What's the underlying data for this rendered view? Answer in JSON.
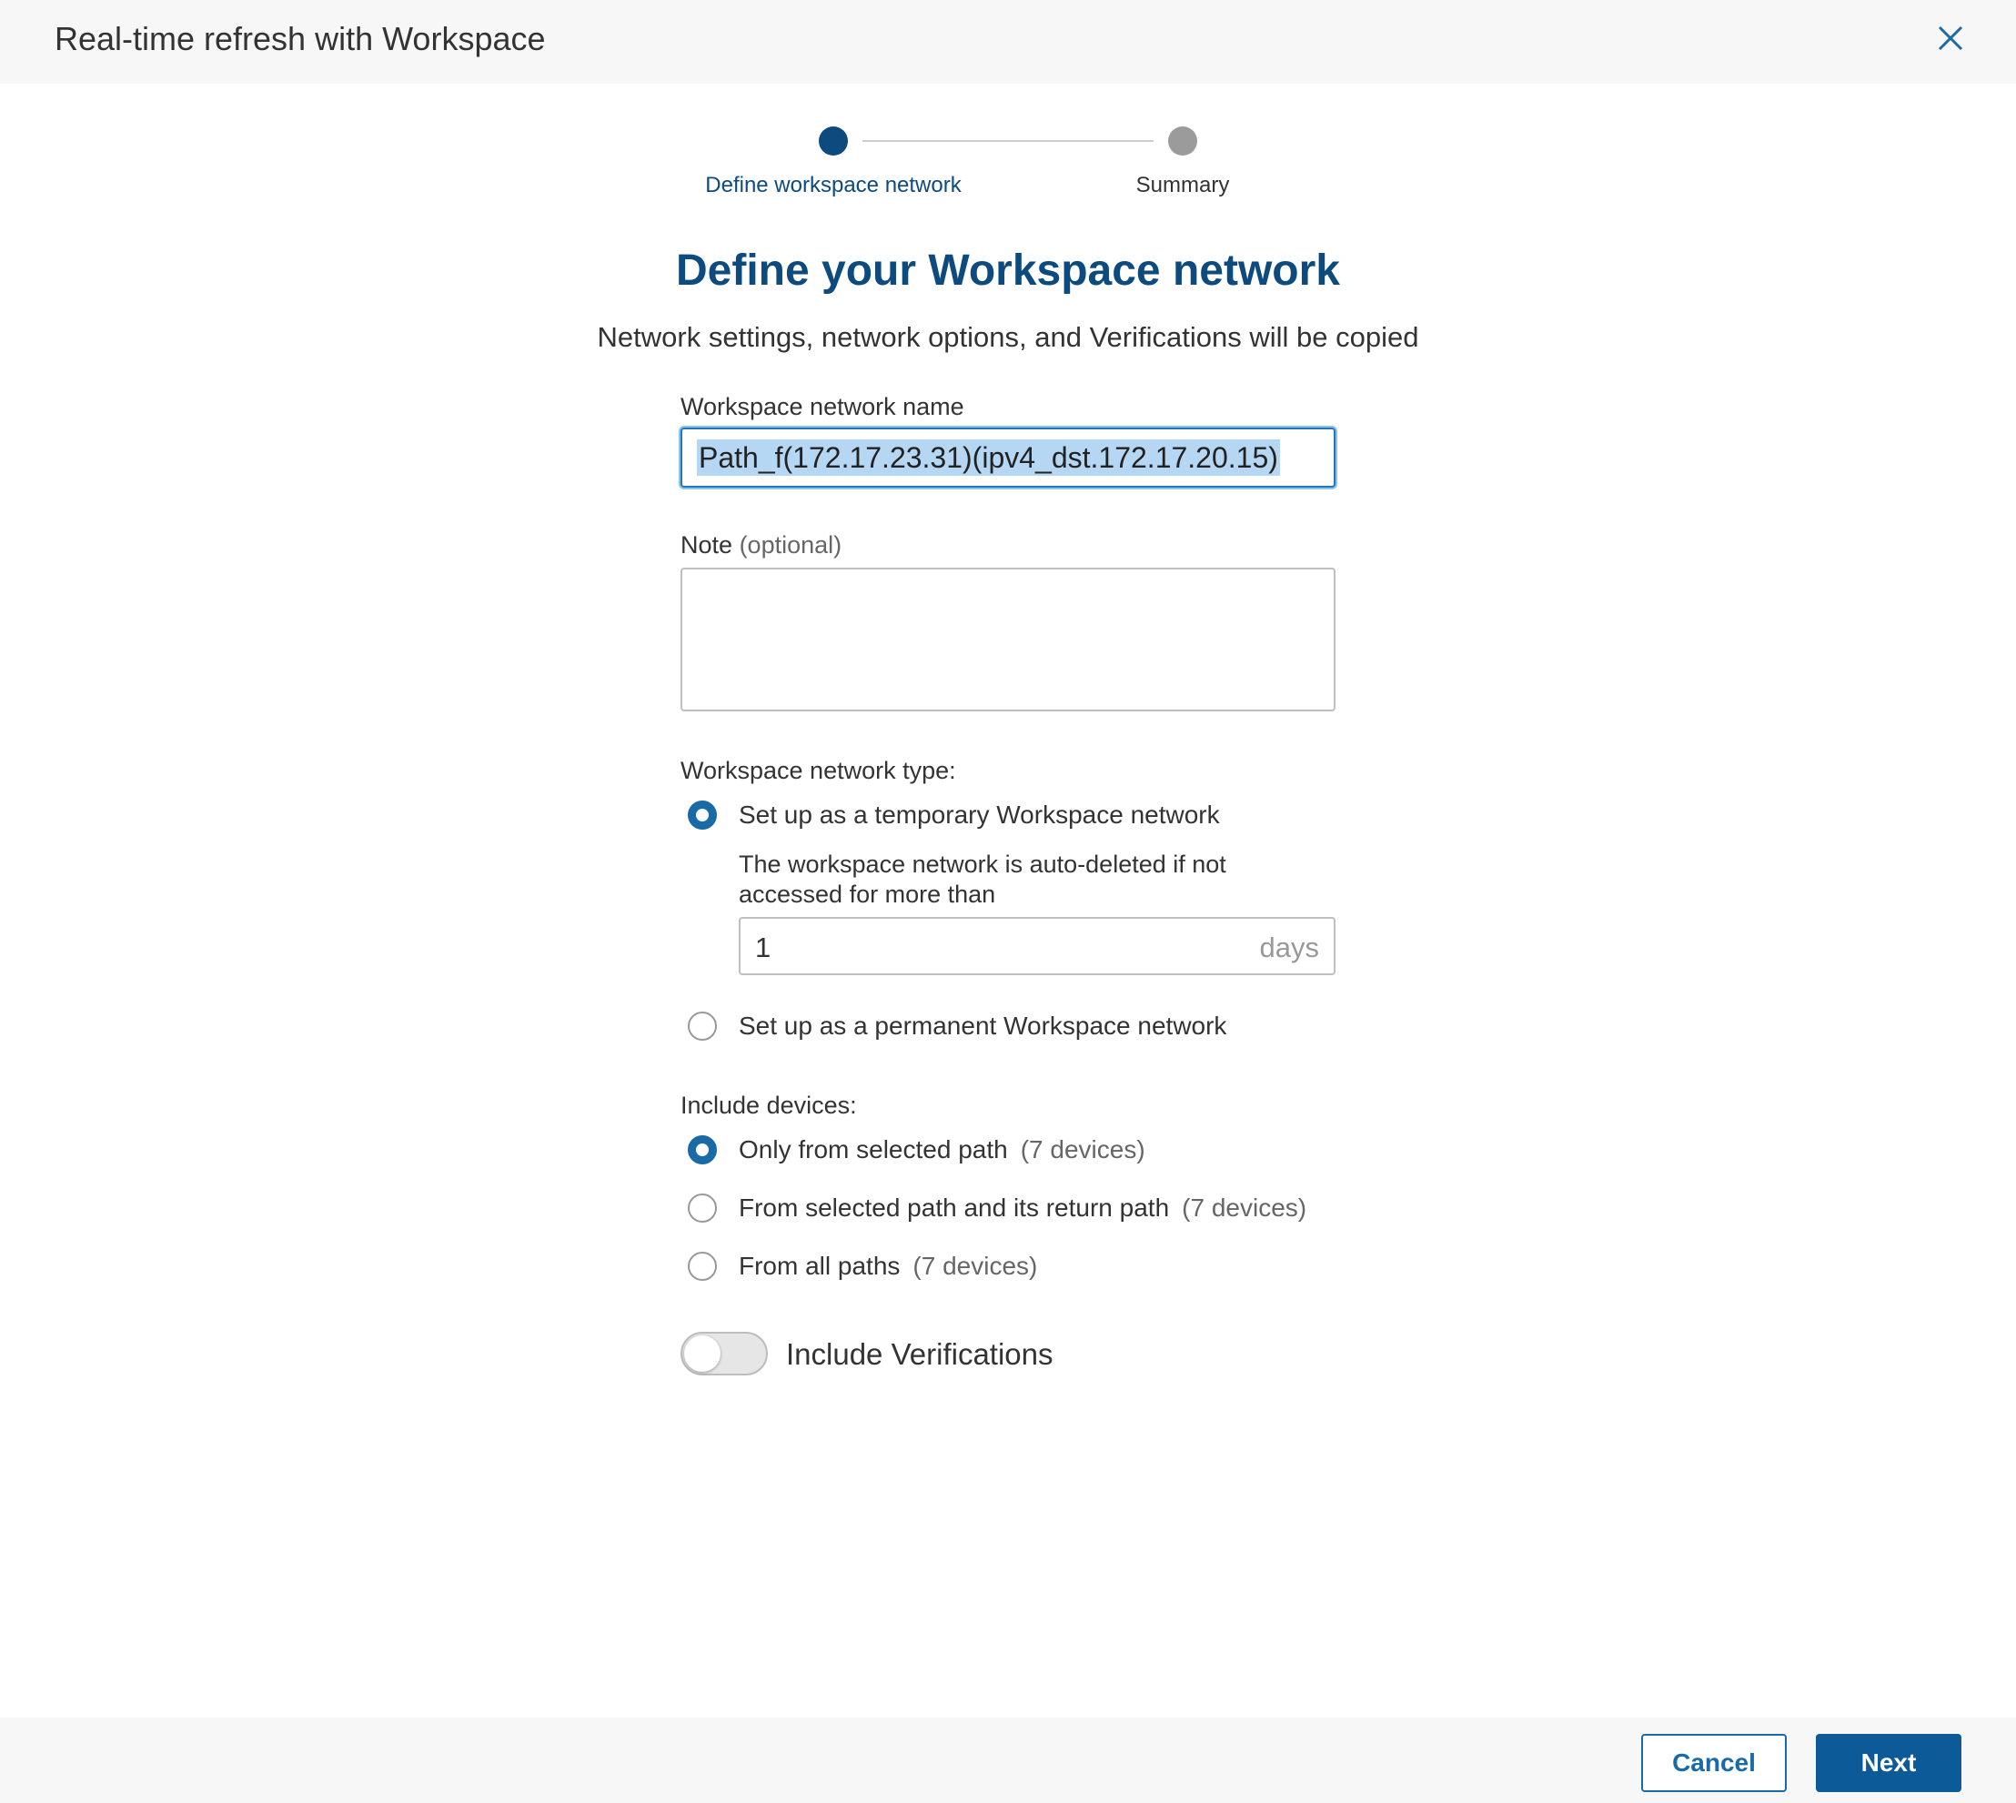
{
  "dialog": {
    "title": "Real-time refresh with Workspace"
  },
  "stepper": {
    "steps": [
      {
        "label": "Define workspace network",
        "state": "active"
      },
      {
        "label": "Summary",
        "state": "inactive"
      }
    ]
  },
  "content": {
    "heading": "Define your Workspace network",
    "subheading": "Network settings, network options, and Verifications will be copied"
  },
  "form": {
    "name_label": "Workspace network name",
    "name_value": "Path_f(172.17.23.31)(ipv4_dst.172.17.20.15)",
    "note_label": "Note",
    "note_optional": "(optional)",
    "note_value": "",
    "type_label": "Workspace network type:",
    "type_options": [
      {
        "label": "Set up as a temporary Workspace network",
        "checked": true
      },
      {
        "label": "Set up as a permanent Workspace network",
        "checked": false
      }
    ],
    "auto_delete_text": "The workspace network is auto-deleted if not accessed for more than",
    "days_value": "1",
    "days_unit": "days",
    "devices_label": "Include devices:",
    "device_options": [
      {
        "label": "Only from selected path",
        "count": "(7 devices)",
        "checked": true
      },
      {
        "label": "From selected path and its return path",
        "count": "(7 devices)",
        "checked": false
      },
      {
        "label": "From all paths",
        "count": "(7 devices)",
        "checked": false
      }
    ],
    "verifications_label": "Include Verifications",
    "verifications_on": false
  },
  "footer": {
    "cancel_label": "Cancel",
    "next_label": "Next"
  },
  "colors": {
    "primary": "#0d4a7e",
    "accent": "#1a6aa8",
    "selection": "#b6d7f3"
  }
}
